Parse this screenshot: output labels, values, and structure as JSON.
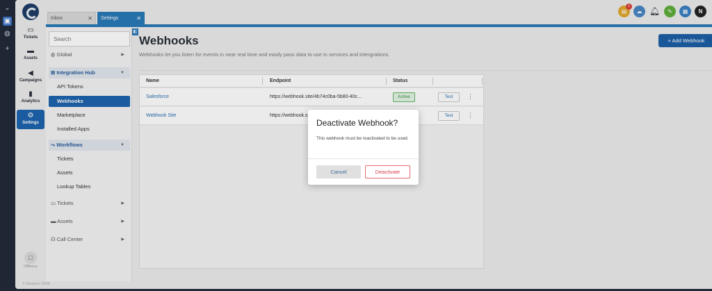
{
  "os_rail": {
    "icons": [
      "chevron-down-icon",
      "app-icon",
      "globe-icon",
      "plus-icon"
    ]
  },
  "nav": {
    "items": [
      {
        "label": "Tickets",
        "icon": "ticket-icon"
      },
      {
        "label": "Assets",
        "icon": "monitor-icon"
      },
      {
        "label": "Campaigns",
        "icon": "megaphone-icon"
      },
      {
        "label": "Analytics",
        "icon": "bar-chart-icon"
      },
      {
        "label": "Settings",
        "icon": "gear-icon"
      }
    ],
    "offline_label": "Offline ▸",
    "copyright": "© Deskpro 2026"
  },
  "tabs": [
    {
      "label": "Inbox"
    },
    {
      "label": "Settings"
    }
  ],
  "top_icons": {
    "notification_badge": "1",
    "avatar_letter": "N"
  },
  "sidebar": {
    "search_placeholder": "Search",
    "global": "Global",
    "integration_hub": "Integration Hub",
    "integration_items": [
      "API Tokens",
      "Webhooks",
      "Marketplace",
      "Installed Apps"
    ],
    "workflows": "Workflows",
    "workflow_items": [
      "Tickets",
      "Assets",
      "Lookup Tables"
    ],
    "tickets": "Tickets",
    "assets": "Assets",
    "call_center": "Call Center"
  },
  "main": {
    "title": "Webhooks",
    "description": "Webhooks let you listen for events in near real time and easily pass data to use in services and intergrations.",
    "add_button": "+ Add Webhook",
    "columns": [
      "Name",
      "Endpoint",
      "Status"
    ],
    "rows": [
      {
        "name": "Salesforce",
        "endpoint": "https://webhook.site/4b74c0ba-5b80-40c...",
        "status": "Active",
        "test": "Test"
      },
      {
        "name": "Webhook Site",
        "endpoint": "https://webhook.site/b",
        "status": "",
        "test": "Test"
      }
    ]
  },
  "modal": {
    "title": "Deactivate Webhook?",
    "body": "This webhook must be reactivated to be used.",
    "cancel": "Cancel",
    "confirm": "Deactivate"
  },
  "colors": {
    "accent": "#1d64ad",
    "danger": "#d8434f",
    "success": "#3c8c45"
  }
}
